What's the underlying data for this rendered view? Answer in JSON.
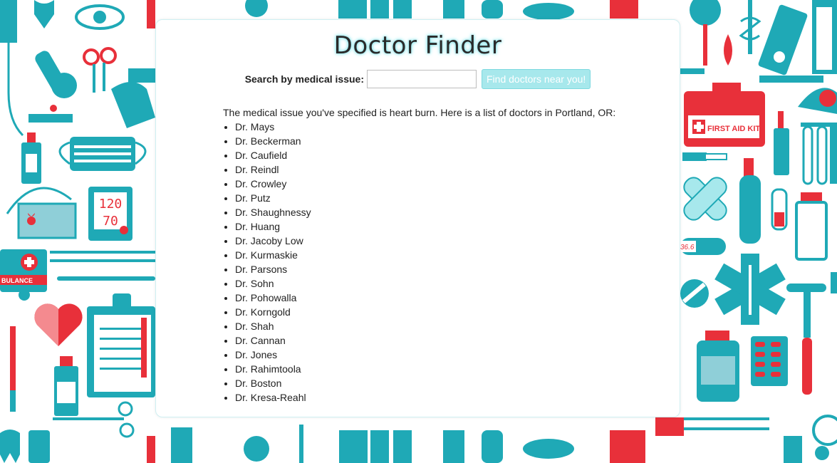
{
  "header": {
    "title": "Doctor Finder"
  },
  "search": {
    "label": "Search by medical issue:",
    "input_value": "",
    "button_label": "Find doctors near you!"
  },
  "results": {
    "intro": "The medical issue you've specified is heart burn. Here is a list of doctors in Portland, OR:",
    "doctors": [
      "Dr. Mays",
      "Dr. Beckerman",
      "Dr. Caufield",
      "Dr. Reindl",
      "Dr. Crowley",
      "Dr. Putz",
      "Dr. Shaughnessy",
      "Dr. Huang",
      "Dr. Jacoby Low",
      "Dr. Kurmaskie",
      "Dr. Parsons",
      "Dr. Sohn",
      "Dr. Pohowalla",
      "Dr. Korngold",
      "Dr. Shah",
      "Dr. Cannan",
      "Dr. Jones",
      "Dr. Rahimtoola",
      "Dr. Boston",
      "Dr. Kresa-Reahl"
    ]
  },
  "background": {
    "left_icons": [
      "eye-icon",
      "scissors-icon",
      "microscope-icon",
      "glove-icon",
      "bottle-icon",
      "mask-icon",
      "blood-pressure-icon",
      "ambulance-icon",
      "heart-icon",
      "clipboard-icon",
      "tooth-icon"
    ],
    "right_icons": [
      "first-aid-kit-icon",
      "bandage-icon",
      "thermometer-icon",
      "star-of-life-icon",
      "pill-icon",
      "test-tube-icon",
      "syringe-icon",
      "blister-pack-icon",
      "iv-bag-icon"
    ],
    "bp_readout_top": "120",
    "bp_readout_bottom": "70",
    "first_aid_text": "FIRST AID KIT",
    "ambulance_text": "BULANCE",
    "thermometer_text": "36.6",
    "colors": {
      "teal": "#1fa9b6",
      "red": "#e8303a",
      "light_teal": "#a7e8ec"
    }
  }
}
